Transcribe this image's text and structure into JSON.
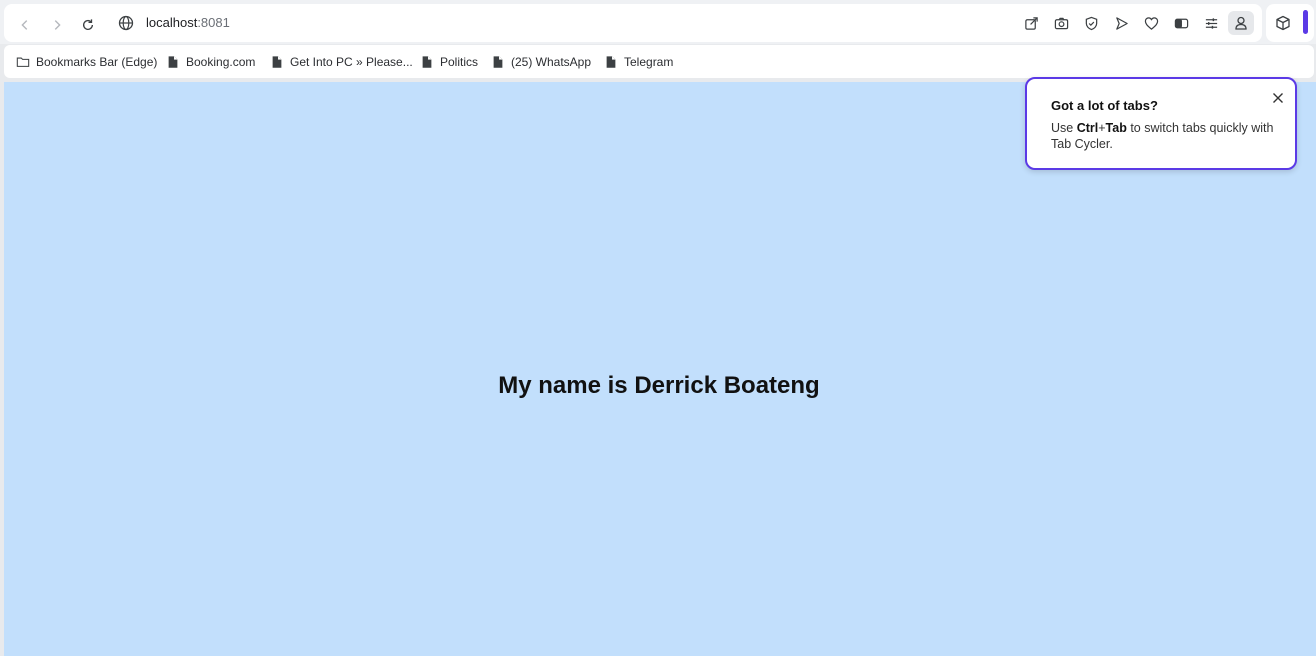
{
  "browser": {
    "url_host": "localhost",
    "url_port": ":8081",
    "accent_color": "#5b3ae6"
  },
  "toolbar_icons": [
    "share-icon",
    "camera-icon",
    "shield-icon",
    "play-icon",
    "heart-icon",
    "theme-icon",
    "sliders-icon",
    "profile-icon",
    "extension-cube-icon"
  ],
  "bookmarks": [
    {
      "label": "Bookmarks Bar (Edge)",
      "icon": "folder-icon"
    },
    {
      "label": "Booking.com",
      "icon": "page-icon"
    },
    {
      "label": "Get Into PC » Please...",
      "icon": "page-icon"
    },
    {
      "label": "Politics",
      "icon": "page-icon"
    },
    {
      "label": "(25) WhatsApp",
      "icon": "page-icon"
    },
    {
      "label": "Telegram",
      "icon": "page-icon"
    }
  ],
  "page": {
    "background": "#c2dffc",
    "headline": "My name is Derrick Boateng"
  },
  "popup": {
    "title": "Got a lot of tabs?",
    "body_prefix": "Use ",
    "shortcut_ctrl": "Ctrl",
    "shortcut_plus": "+",
    "shortcut_tab": "Tab",
    "body_suffix": " to switch tabs quickly with Tab Cycler."
  }
}
